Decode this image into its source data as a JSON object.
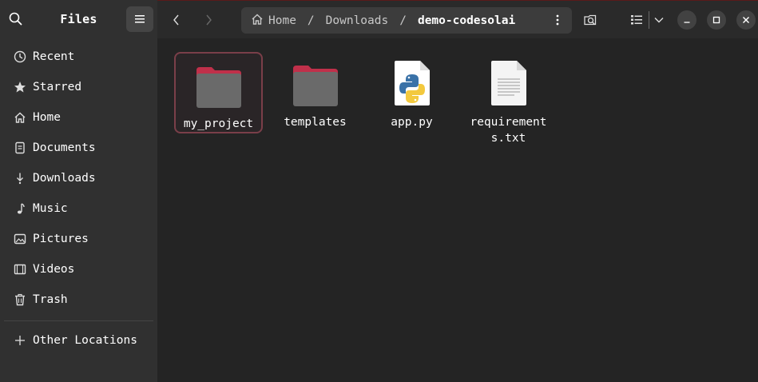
{
  "app": {
    "title": "Files"
  },
  "sidebar": {
    "items": [
      {
        "label": "Recent",
        "icon": "clock-icon"
      },
      {
        "label": "Starred",
        "icon": "star-icon"
      },
      {
        "label": "Home",
        "icon": "home-icon"
      },
      {
        "label": "Documents",
        "icon": "document-icon"
      },
      {
        "label": "Downloads",
        "icon": "download-icon"
      },
      {
        "label": "Music",
        "icon": "music-icon"
      },
      {
        "label": "Pictures",
        "icon": "picture-icon"
      },
      {
        "label": "Videos",
        "icon": "video-icon"
      },
      {
        "label": "Trash",
        "icon": "trash-icon"
      }
    ],
    "other_locations": "Other Locations"
  },
  "pathbar": {
    "crumbs": [
      "Home",
      "Downloads",
      "demo-codesolai"
    ],
    "separator": "/"
  },
  "files": [
    {
      "name": "my_project",
      "type": "folder",
      "selected": true
    },
    {
      "name": "templates",
      "type": "folder",
      "selected": false
    },
    {
      "name": "app.py",
      "type": "python",
      "selected": false
    },
    {
      "name": "requirements.txt",
      "type": "text",
      "selected": false
    }
  ],
  "colors": {
    "folder_tab": "#c0304a",
    "folder_body": "#6a6a6a",
    "selection_border": "#7a3f49"
  }
}
